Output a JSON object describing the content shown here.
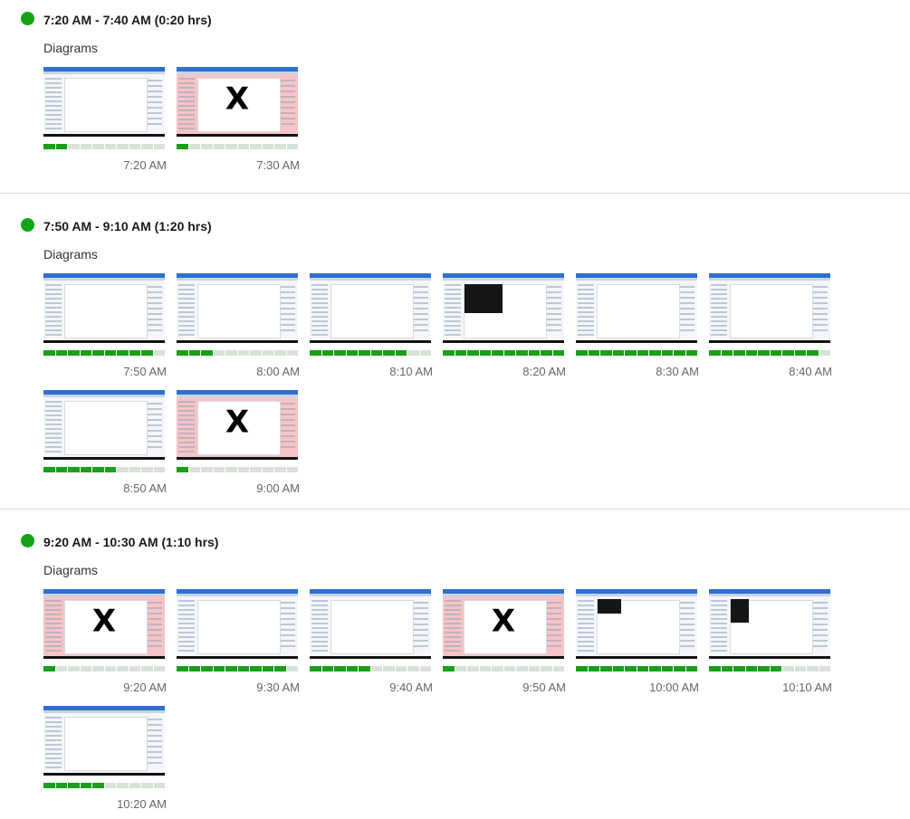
{
  "sessions": [
    {
      "range": "7:20 AM - 7:40 AM",
      "duration": "(0:20 hrs)",
      "memo": "Diagrams",
      "shots": [
        {
          "time": "7:20 AM",
          "activity_segments": 2,
          "deleted": false
        },
        {
          "time": "7:30 AM",
          "activity_segments": 1,
          "deleted": true
        }
      ]
    },
    {
      "range": "7:50 AM - 9:10 AM",
      "duration": "(1:20 hrs)",
      "memo": "Diagrams",
      "shots": [
        {
          "time": "7:50 AM",
          "activity_segments": 9,
          "deleted": false
        },
        {
          "time": "8:00 AM",
          "activity_segments": 3,
          "deleted": false
        },
        {
          "time": "8:10 AM",
          "activity_segments": 8,
          "deleted": false
        },
        {
          "time": "8:20 AM",
          "activity_segments": 10,
          "deleted": false
        },
        {
          "time": "8:30 AM",
          "activity_segments": 10,
          "deleted": false
        },
        {
          "time": "8:40 AM",
          "activity_segments": 9,
          "deleted": false
        },
        {
          "time": "8:50 AM",
          "activity_segments": 6,
          "deleted": false
        },
        {
          "time": "9:00 AM",
          "activity_segments": 1,
          "deleted": true
        }
      ]
    },
    {
      "range": "9:20 AM - 10:30 AM",
      "duration": "(1:10 hrs)",
      "memo": "Diagrams",
      "shots": [
        {
          "time": "9:20 AM",
          "activity_segments": 1,
          "deleted": true
        },
        {
          "time": "9:30 AM",
          "activity_segments": 9,
          "deleted": false
        },
        {
          "time": "9:40 AM",
          "activity_segments": 5,
          "deleted": false
        },
        {
          "time": "9:50 AM",
          "activity_segments": 1,
          "deleted": true
        },
        {
          "time": "10:00 AM",
          "activity_segments": 10,
          "deleted": false
        },
        {
          "time": "10:10 AM",
          "activity_segments": 6,
          "deleted": false
        },
        {
          "time": "10:20 AM",
          "activity_segments": 5,
          "deleted": false
        }
      ]
    }
  ],
  "deleted_mark": "X",
  "activity_total_segments": 10,
  "colors": {
    "online_dot": "#14a314",
    "activity_on": "#18a018",
    "activity_off": "#d8e3d8",
    "deleted_overlay": "#f6c4c6"
  }
}
